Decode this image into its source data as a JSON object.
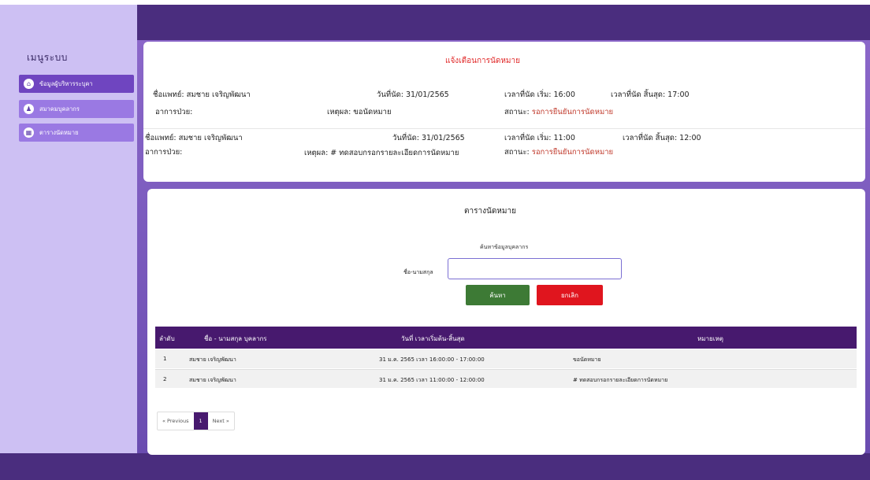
{
  "sidebar": {
    "title": "เมนูระบบ",
    "items": [
      {
        "label": "ข้อมูลผู้บริหารระบุคา",
        "icon": "home-icon"
      },
      {
        "label": "สมาคมบุคลากร",
        "icon": "user-icon"
      },
      {
        "label": "ตารางนัดหมาย",
        "icon": "calendar-icon"
      }
    ]
  },
  "notice": {
    "title": "แจ้งเตือนการนัดหมาย",
    "entries": [
      {
        "doctor": "ชื่อแพทย์: สมชาย เจริญพัฒนา",
        "date": "วันที่นัด: 31/01/2565",
        "start": "เวลาที่นัด เริ่ม: 16:00",
        "end": "เวลาที่นัด สิ้นสุด: 17:00",
        "symptom": "อาการป่วย:",
        "reason": "เหตุผล: ขอนัดหมาย",
        "status_label": "สถานะ:",
        "status": "รอการยืนยันการนัดหมาย"
      },
      {
        "doctor": "ชื่อแพทย์: สมชาย เจริญพัฒนา",
        "date": "วันที่นัด: 31/01/2565",
        "start": "เวลาที่นัด เริ่ม: 11:00",
        "end": "เวลาที่นัด สิ้นสุด: 12:00",
        "symptom": "อาการป่วย:",
        "reason": "เหตุผล: # ทดสอบกรอกรายละเอียดการนัดหมาย",
        "status_label": "สถานะ:",
        "status": "รอการยืนยันการนัดหมาย"
      }
    ]
  },
  "schedule": {
    "title": "ตารางนัดหมาย",
    "search_title": "ค้นหาข้อมูลบุคลากร",
    "search_label": "ชื่อ-นามสกุล",
    "search_value": "",
    "search_button": "ค้นหา",
    "cancel_button": "ยกเลิก",
    "columns": [
      "ลำดับ",
      "ชื่อ - นามสกุล บุคลากร",
      "วันที่ เวลาเริ่มต้น-สิ้นสุด",
      "หมายเหตุ"
    ],
    "rows": [
      {
        "no": "1",
        "name": "สมชาย เจริญพัฒนา",
        "datetime": "31 ม.ค. 2565 เวลา 16:00:00 - 17:00:00",
        "note": "ขอนัดหมาย"
      },
      {
        "no": "2",
        "name": "สมชาย เจริญพัฒนา",
        "datetime": "31 ม.ค. 2565 เวลา 11:00:00 - 12:00:00",
        "note": "# ทดสอบกรอกรายละเอียดการนัดหมาย"
      }
    ],
    "pager": {
      "prev": "« Previous",
      "current": "1",
      "next": "Next »"
    }
  },
  "colors": {
    "header": "#4a2d7e",
    "sidebar": "#cdc0f3",
    "table_header": "#47196e",
    "search_button": "#3d7a35",
    "cancel_button": "#e0151e",
    "alert": "#e02828"
  }
}
